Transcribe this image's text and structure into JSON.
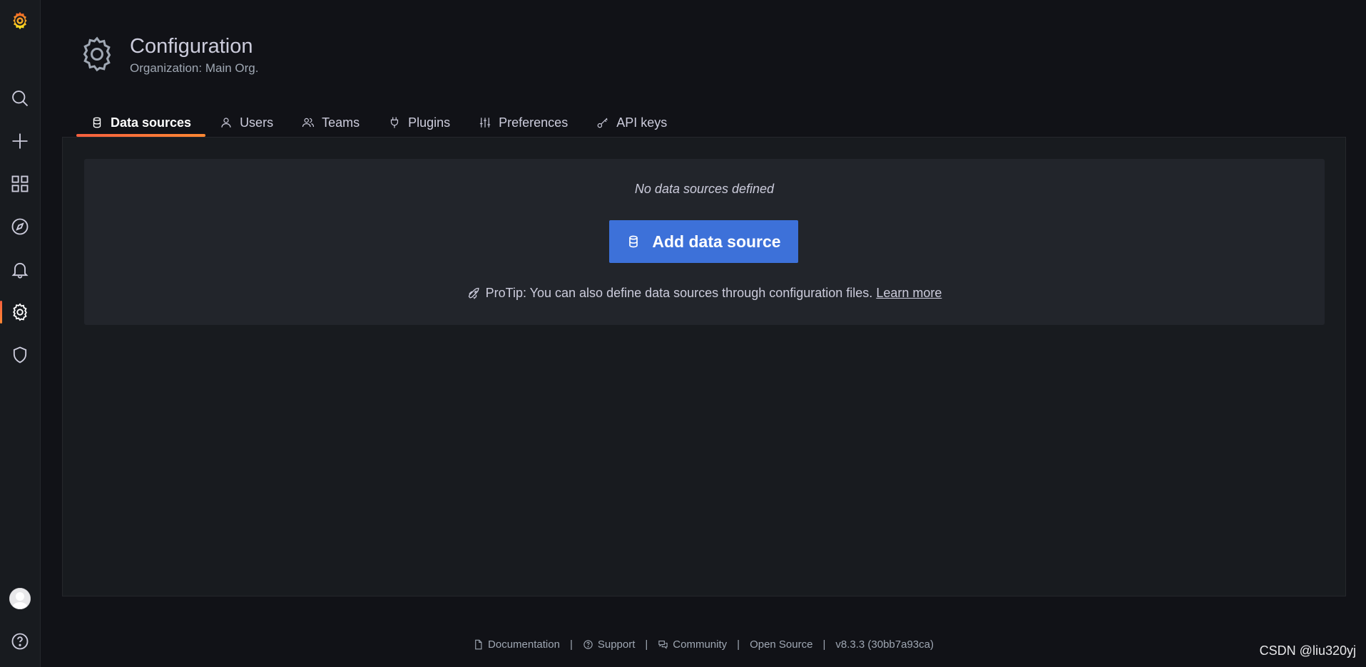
{
  "sidebar": {
    "logo": "grafana-logo-icon",
    "items": [
      {
        "name": "search-icon"
      },
      {
        "name": "plus-icon"
      },
      {
        "name": "dashboards-icon"
      },
      {
        "name": "explore-icon"
      },
      {
        "name": "alerting-icon"
      },
      {
        "name": "gear-icon",
        "active": true
      },
      {
        "name": "shield-icon"
      }
    ],
    "bottom": [
      {
        "name": "avatar"
      },
      {
        "name": "help-icon"
      }
    ]
  },
  "header": {
    "title": "Configuration",
    "subtitle": "Organization: Main Org."
  },
  "tabs": [
    {
      "label": "Data sources",
      "icon": "database-icon",
      "active": true
    },
    {
      "label": "Users",
      "icon": "user-icon"
    },
    {
      "label": "Teams",
      "icon": "users-icon"
    },
    {
      "label": "Plugins",
      "icon": "plug-icon"
    },
    {
      "label": "Preferences",
      "icon": "sliders-icon"
    },
    {
      "label": "API keys",
      "icon": "key-icon"
    }
  ],
  "empty_state": {
    "title": "No data sources defined",
    "button_label": "Add data source",
    "protip_text": "ProTip: You can also define data sources through configuration files.",
    "protip_link": "Learn more"
  },
  "footer": {
    "documentation": "Documentation",
    "support": "Support",
    "community": "Community",
    "open_source": "Open Source",
    "version": "v8.3.3 (30bb7a93ca)",
    "separator": "|"
  },
  "watermark": "CSDN @liu320yj",
  "colors": {
    "background": "#111217",
    "panel": "#181b1f",
    "card": "#22252b",
    "primary_button": "#3d71d9",
    "accent_gradient_start": "#f55f3e",
    "accent_gradient_end": "#ff8833"
  }
}
